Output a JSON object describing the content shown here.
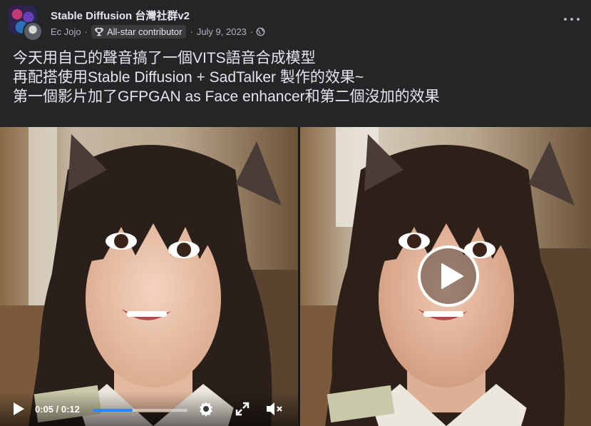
{
  "group": {
    "name": "Stable Diffusion 台灣社群v2"
  },
  "author": {
    "name": "Ec Jojo",
    "badge": "All-star contributor"
  },
  "post": {
    "date": "July 9, 2023",
    "lines": [
      "今天用自己的聲音搞了一個VITS語音合成模型",
      "再配搭使用Stable Diffusion + SadTalker 製作的效果~",
      "第一個影片加了GFPGAN as Face enhancer和第二個沒加的效果"
    ]
  },
  "video1": {
    "current": "0:05",
    "duration": "0:12",
    "progress": 0.42,
    "time_text": "0:05 / 0:12"
  },
  "icons": [
    "group-avatar",
    "trophy-icon",
    "globe-icon",
    "more-icon",
    "play-icon",
    "settings-icon",
    "fullscreen-icon",
    "mute-icon"
  ],
  "colors": {
    "background": "#242526",
    "text": "#e4e6eb",
    "secondary": "#b0b3b8",
    "progress": "#2d88ff"
  }
}
